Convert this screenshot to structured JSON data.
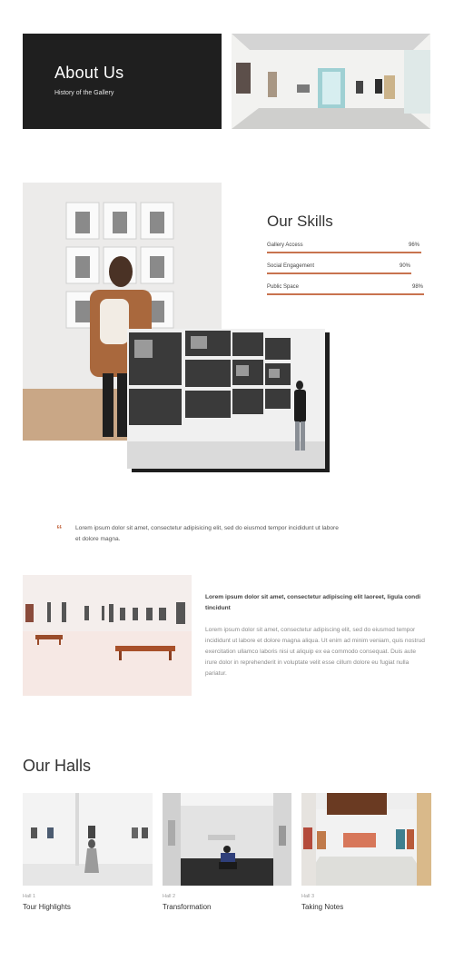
{
  "hero": {
    "title": "About Us",
    "subtitle": "History of the Gallery"
  },
  "skills": {
    "title": "Our Skills",
    "accent_color": "#c8734f",
    "items": [
      {
        "label": "Gallery Access",
        "value_text": "96%",
        "value": 0.96
      },
      {
        "label": "Social Engagement",
        "value_text": "90%",
        "value": 0.9
      },
      {
        "label": "Public Space",
        "value_text": "98%",
        "value": 0.98
      }
    ]
  },
  "quote": {
    "mark": "“",
    "text": "Lorem ipsum dolor sit amet, consectetur adipisicing elit, sed do eiusmod tempor incididunt ut labore et dolore magna."
  },
  "text_block": {
    "heading": "Lorem ipsum dolor sit amet, consectetur adipiscing elit laoreet, ligula condi tincidunt",
    "body": "Lorem ipsum dolor sit amet, consectetur adipiscing elit, sed do eiusmod tempor incididunt ut labore et dolore magna aliqua. Ut enim ad minim veniam, quis nostrud exercitation ullamco laboris nisi ut aliquip ex ea commodo consequat. Duis aute irure dolor in reprehenderit in voluptate velit esse cillum dolore eu fugiat nulla pariatur."
  },
  "halls": {
    "title": "Our Halls",
    "items": [
      {
        "number": "Hall 1",
        "name": "Tour Highlights"
      },
      {
        "number": "Hall 2",
        "name": "Transformation"
      },
      {
        "number": "Hall 3",
        "name": "Taking Notes"
      }
    ]
  }
}
